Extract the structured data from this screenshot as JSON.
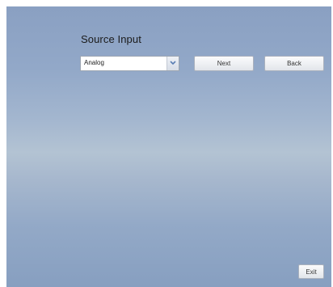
{
  "screen": {
    "title": "Source Input"
  },
  "source_select": {
    "value": "Analog",
    "icon": "chevron-down-icon"
  },
  "buttons": {
    "next": "Next",
    "back": "Back",
    "exit": "Exit"
  },
  "colors": {
    "background_top": "#8aa0c2",
    "background_mid": "#b3c3d3",
    "background_bottom": "#879fc0",
    "chevron": "#5b7fb4"
  }
}
